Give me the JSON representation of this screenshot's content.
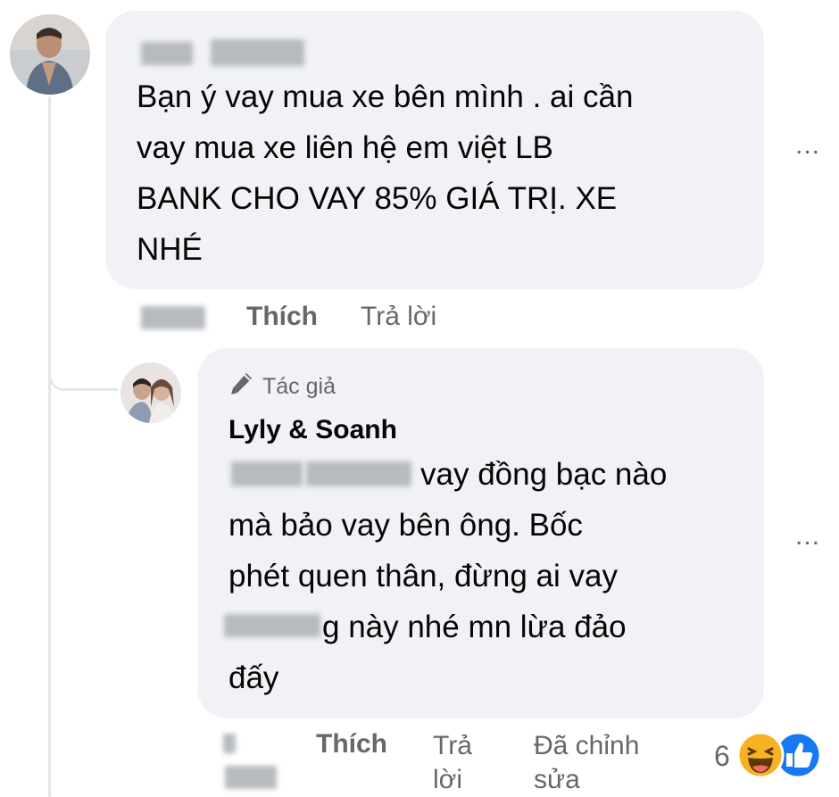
{
  "thread": {
    "comment1": {
      "text": "Bạn ý vay mua xe bên mình . ai cần\nvay mua xe liên hệ em việt LB\nBANK CHO VAY 85% GIÁ TRỊ. XE\nNHÉ",
      "actions": {
        "like_label": "Thích",
        "reply_label": "Trả lời"
      },
      "more_label": "..."
    },
    "reply1": {
      "badge_label": "Tác giả",
      "author": "Lyly & Soanh",
      "text_line1": "vay đồng bạc nào",
      "text_line2": "mà bảo vay bên ông. Bốc",
      "text_line3": "phét quen thân, đừng ai vay",
      "text_line4": "g này nhé mn lừa đảo",
      "text_line5": "đấy",
      "actions": {
        "like_label": "Thích",
        "reply_line1": "Trả",
        "reply_line2": "lời",
        "edited_line1": "Đã chỉnh",
        "edited_line2": "sửa"
      },
      "reactions": {
        "count": "6",
        "types": [
          "haha",
          "like"
        ]
      },
      "more_label": "..."
    }
  },
  "colors": {
    "bubble": "#f0f2f5",
    "secondary_text": "#65676b",
    "like_blue": "#1877f2",
    "haha_yellow": "#f7b125"
  }
}
